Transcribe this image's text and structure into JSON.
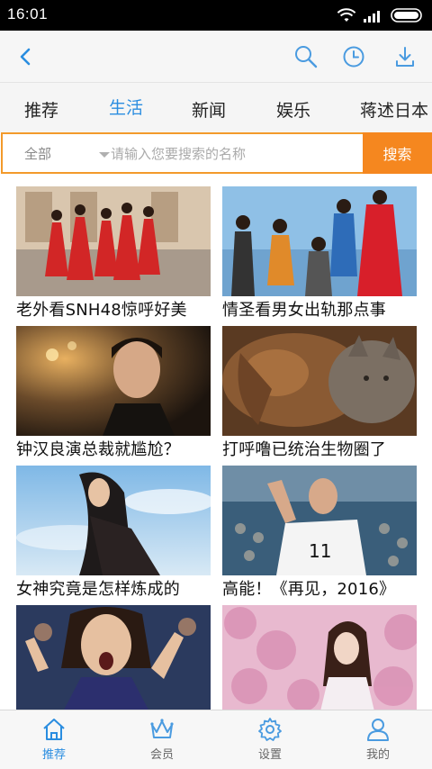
{
  "status_bar": {
    "time": "16:01",
    "icons": [
      "wifi-icon",
      "signal-icon",
      "battery-icon"
    ]
  },
  "toolbar": {
    "icons": [
      "back-icon",
      "search-icon",
      "history-icon",
      "download-icon"
    ],
    "accent_color": "#2a8de0"
  },
  "tabs": [
    {
      "label": "推荐",
      "active": false
    },
    {
      "label": "生活",
      "active": true
    },
    {
      "label": "新闻",
      "active": false
    },
    {
      "label": "娱乐",
      "active": false
    },
    {
      "label": "蒋述日本",
      "active": false
    }
  ],
  "search": {
    "scope": "全部",
    "placeholder": "请输入您要搜索的名称",
    "button_label": "搜索",
    "button_color": "#f5871f"
  },
  "videos": [
    {
      "title": "老外看SNH48惊呼好美"
    },
    {
      "title": "情圣看男女出轨那点事"
    },
    {
      "title": "钟汉良演总裁就尴尬？"
    },
    {
      "title": "打呼噜已统治生物圈了"
    },
    {
      "title": "女神究竟是怎样炼成的"
    },
    {
      "title": "高能！《再见，2016》"
    },
    {
      "title": ""
    },
    {
      "title": ""
    }
  ],
  "bottom_nav": [
    {
      "label": "推荐",
      "icon": "home-icon",
      "active": true
    },
    {
      "label": "会员",
      "icon": "crown-icon",
      "active": false
    },
    {
      "label": "设置",
      "icon": "gear-icon",
      "active": false
    },
    {
      "label": "我的",
      "icon": "user-icon",
      "active": false
    }
  ]
}
